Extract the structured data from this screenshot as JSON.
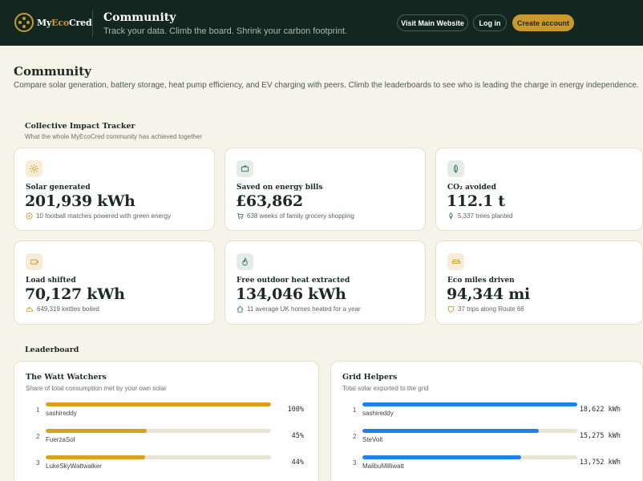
{
  "brand": {
    "name_prefix": "My",
    "name_accent": "Eco",
    "name_suffix": "Cred",
    "accent_color": "#c9982e"
  },
  "header": {
    "title": "Community",
    "subtitle": "Track your data. Climb the board. Shrink your carbon footprint.",
    "visit_label": "Visit Main Website",
    "login_label": "Log in",
    "create_label": "Create account"
  },
  "page": {
    "title": "Community",
    "subtitle": "Compare solar generation, battery storage, heat pump efficiency, and EV charging with peers. Climb the leaderboards to see who is leading the charge in energy independence."
  },
  "impact": {
    "title": "Collective Impact Tracker",
    "subtitle": "What the whole MyEcoCred community has achieved together",
    "cards": [
      {
        "icon": "sun-icon",
        "label": "Solar generated",
        "value": "201,939 kWh",
        "note_icon": "football-icon",
        "note": "10 football matches powered with green energy"
      },
      {
        "icon": "wallet-icon",
        "label": "Saved on energy bills",
        "value": "£63,862",
        "note_icon": "cart-icon",
        "note": "638 weeks of family grocery shopping"
      },
      {
        "icon": "leaf-icon",
        "label": "CO₂ avoided",
        "value": "112.1 t",
        "note_icon": "tree-icon",
        "note": "5,337 trees planted"
      },
      {
        "icon": "battery-icon",
        "label": "Load shifted",
        "value": "70,127 kWh",
        "note_icon": "kettle-icon",
        "note": "649,319 kettles boiled"
      },
      {
        "icon": "flame-icon",
        "label": "Free outdoor heat extracted",
        "value": "134,046 kWh",
        "note_icon": "home-icon",
        "note": "11 average UK homes heated for a year"
      },
      {
        "icon": "car-icon",
        "label": "Eco miles driven",
        "value": "94,344 mi",
        "note_icon": "route-shield-icon",
        "note": "37 trips along Route 66"
      }
    ]
  },
  "leaderboard": {
    "title": "Leaderboard",
    "boards": [
      {
        "title": "The Watt Watchers",
        "subtitle": "Share of total consumption met by your own solar",
        "color": "#d9a21b",
        "rows": [
          {
            "rank": "1",
            "name": "sashireddy",
            "score": "100%",
            "fraction": 1.0
          },
          {
            "rank": "2",
            "name": "FuerzaSol",
            "score": "45%",
            "fraction": 0.45
          },
          {
            "rank": "3",
            "name": "LukeSkyWattwalker",
            "score": "44%",
            "fraction": 0.44
          }
        ]
      },
      {
        "title": "Grid Helpers",
        "subtitle": "Total solar exported to the grid",
        "color": "#1f82e8",
        "rows": [
          {
            "rank": "1",
            "name": "sashireddy",
            "score": "18,622 kWh",
            "fraction": 1.0
          },
          {
            "rank": "2",
            "name": "SteVolt",
            "score": "15,275 kWh",
            "fraction": 0.82
          },
          {
            "rank": "3",
            "name": "MalibuMilliwatt",
            "score": "13,752 kWh",
            "fraction": 0.738
          }
        ]
      }
    ]
  }
}
